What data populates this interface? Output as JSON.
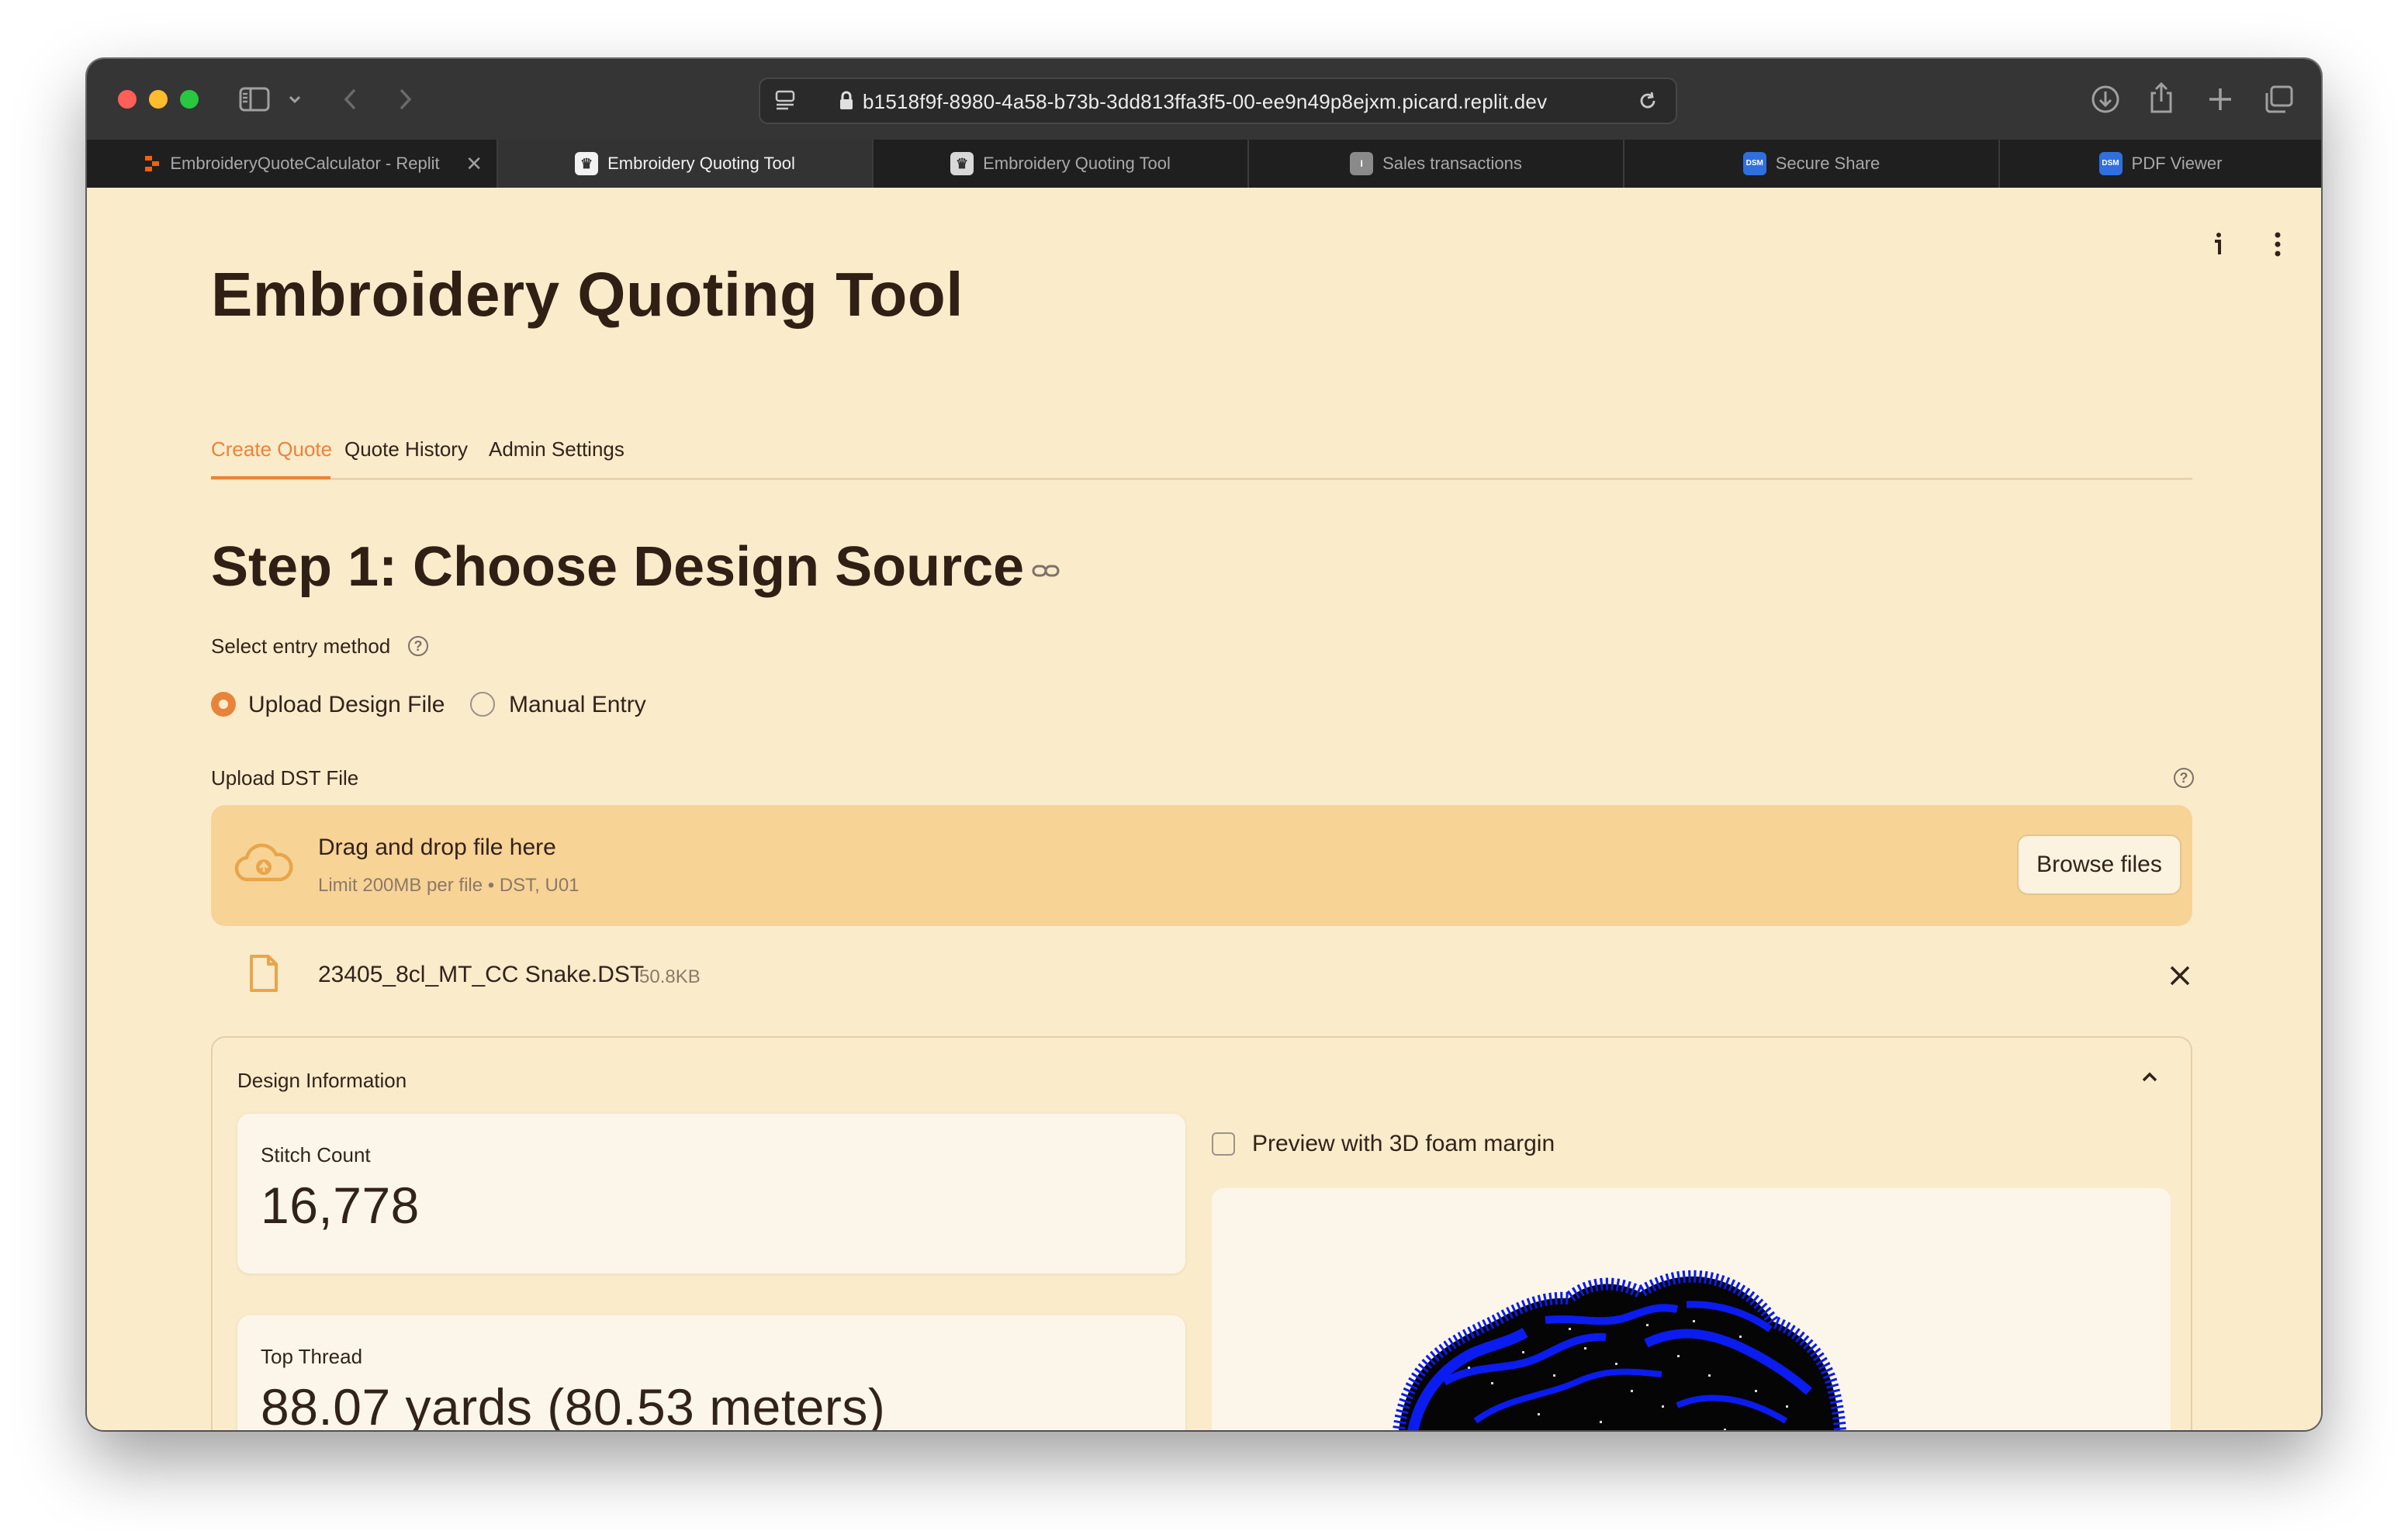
{
  "browser": {
    "url": "b1518f9f-8980-4a58-b73b-3dd813ffa3f5-00-ee9n49p8ejxm.picard.replit.dev",
    "tabs": [
      {
        "label": "EmbroideryQuoteCalculator - Replit",
        "favicon": "replit-icon",
        "active": false,
        "closable": true
      },
      {
        "label": "Embroidery Quoting Tool",
        "favicon": "streamlit-crown-icon",
        "active": true
      },
      {
        "label": "Embroidery Quoting Tool",
        "favicon": "streamlit-crown-icon",
        "active": false
      },
      {
        "label": "Sales transactions",
        "favicon": "doc-icon",
        "active": false
      },
      {
        "label": "Secure Share",
        "favicon": "dsm-icon",
        "favicon_text": "DSM",
        "active": false
      },
      {
        "label": "PDF Viewer",
        "favicon": "dsm-icon",
        "favicon_text": "DSM",
        "active": false
      }
    ]
  },
  "app": {
    "title": "Embroidery Quoting Tool",
    "nav_tabs": [
      {
        "label": "Create Quote",
        "active": true
      },
      {
        "label": "Quote History",
        "active": false
      },
      {
        "label": "Admin Settings",
        "active": false
      }
    ]
  },
  "step1": {
    "heading": "Step 1: Choose Design Source",
    "entry_label": "Select entry method",
    "options": [
      {
        "label": "Upload Design File",
        "selected": true
      },
      {
        "label": "Manual Entry",
        "selected": false
      }
    ]
  },
  "upload": {
    "label": "Upload DST File",
    "drop_title": "Drag and drop file here",
    "drop_limit": "Limit 200MB per file • DST, U01",
    "browse_label": "Browse files",
    "file_name": "23405_8cl_MT_CC Snake.DST",
    "file_size": "50.8KB"
  },
  "design_info": {
    "title": "Design Information",
    "expanded": true,
    "stitch_count_label": "Stitch Count",
    "stitch_count_value": "16,778",
    "top_thread_label": "Top Thread",
    "top_thread_value": "88.07 yards (80.53 meters)",
    "preview_checkbox_label": "Preview with 3D foam margin",
    "preview_checked": false
  },
  "colors": {
    "accent": "#e8843a",
    "page_bg": "#faebcb",
    "dropzone_bg": "#f8d396",
    "text": "#31231a",
    "design_blue": "#0b1cf0"
  }
}
